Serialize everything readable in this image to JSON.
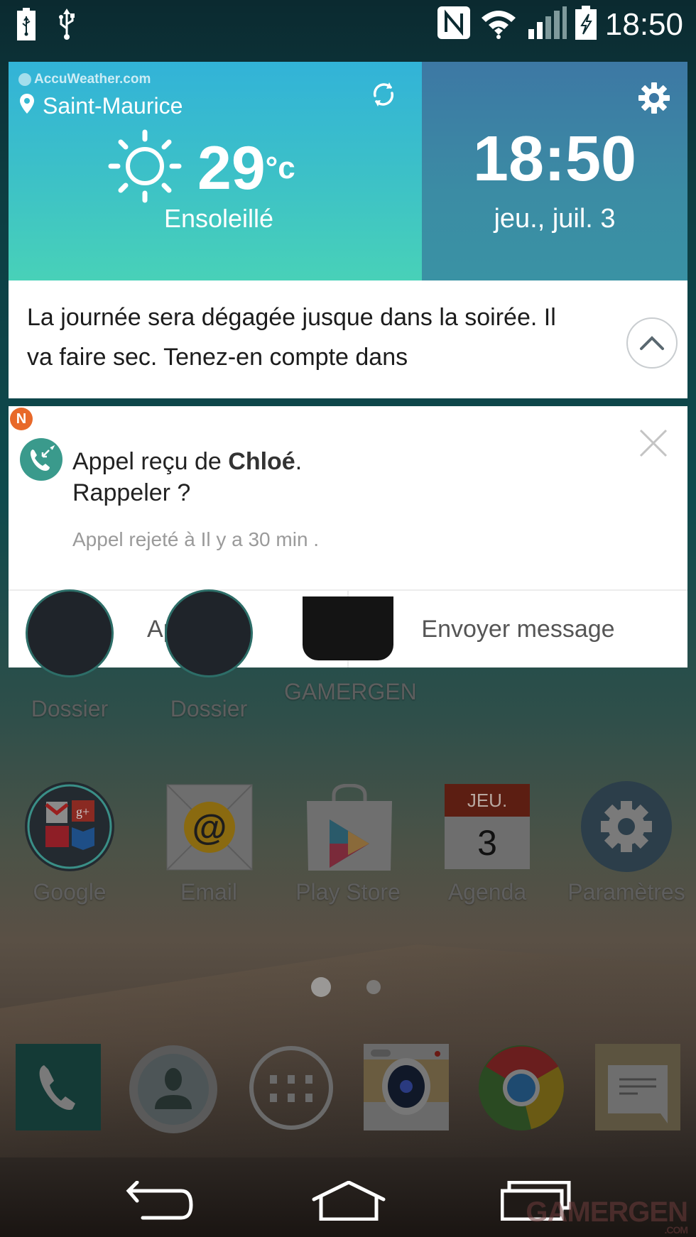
{
  "status_bar": {
    "time": "18:50",
    "left_icons": [
      "usb-battery-icon",
      "usb-icon"
    ],
    "right_icons": [
      "nfc-icon",
      "wifi-icon",
      "signal-icon",
      "battery-charging-icon"
    ]
  },
  "weather_widget": {
    "provider": "AccuWeather.com",
    "location": "Saint-Maurice",
    "temperature": "29",
    "unit": "°c",
    "condition": "Ensoleillé",
    "clock_time": "18:50",
    "date": "jeu., juil. 3",
    "forecast_text": "La journée sera dégagée jusque dans la soirée. Il va faire sec. Tenez-en compte dans",
    "colors": {
      "left_top": "#32b3d8",
      "left_bottom": "#48d1b8",
      "right": "#3b84a4"
    }
  },
  "notification": {
    "badge": "N",
    "title_prefix": "Appel reçu de ",
    "caller": "Chloé",
    "title_suffix": ".",
    "subtitle": "Rappeler ?",
    "meta": "Appel rejeté à Il y a 30 min .",
    "actions": [
      {
        "label": "Appel"
      },
      {
        "label": "Envoyer message"
      }
    ],
    "colors": {
      "badge": "#e8692a",
      "icon": "#3a9a8c"
    }
  },
  "home_screen": {
    "row1": [
      {
        "label": "Dossier"
      },
      {
        "label": "Dossier"
      },
      {
        "label": "GAMERGEN"
      }
    ],
    "row2": [
      {
        "label": "Google"
      },
      {
        "label": "Email"
      },
      {
        "label": "Play Store"
      },
      {
        "label": "Agenda",
        "calendar_day": "JEU.",
        "calendar_date": "3"
      },
      {
        "label": "Paramètres"
      }
    ],
    "page_indicator": {
      "pages": 2,
      "current": 1
    },
    "dock": [
      "phone-app",
      "contacts-app",
      "app-drawer",
      "camera-app",
      "chrome-app",
      "messages-app"
    ]
  },
  "watermark": {
    "text": "GAMERGEN",
    "sub": ".COM"
  }
}
